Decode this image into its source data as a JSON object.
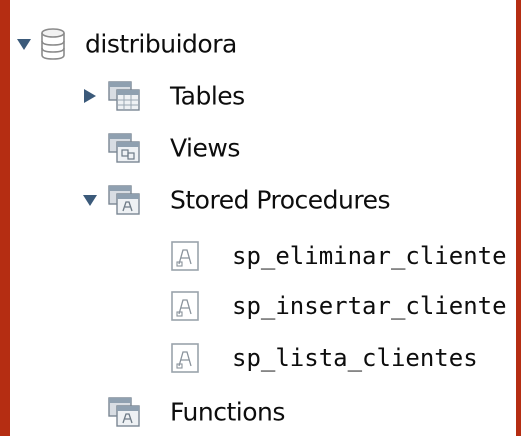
{
  "tree": {
    "schema": {
      "label": "distribuidora",
      "expanded": true,
      "icon": "database-icon"
    },
    "folders": [
      {
        "label": "Tables",
        "expanded": false,
        "icon": "tables-folder-icon"
      },
      {
        "label": "Views",
        "icon": "views-folder-icon"
      },
      {
        "label": "Stored Procedures",
        "expanded": true,
        "icon": "procedures-folder-icon"
      },
      {
        "label": "Functions",
        "icon": "functions-folder-icon"
      }
    ],
    "procedures": [
      {
        "label": "sp_eliminar_cliente",
        "icon": "stored-procedure-icon"
      },
      {
        "label": "sp_insertar_cliente",
        "icon": "stored-procedure-icon"
      },
      {
        "label": "sp_lista_clientes",
        "icon": "stored-procedure-icon"
      }
    ]
  },
  "colors": {
    "background": "#b52d12",
    "panel": "#ffffff",
    "text": "#0d0d0d",
    "arrow": "#3b5a7a"
  }
}
